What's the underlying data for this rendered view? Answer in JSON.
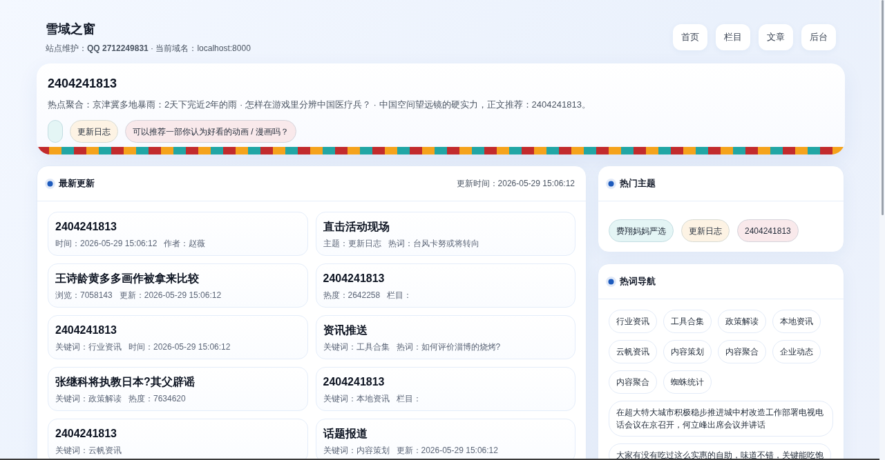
{
  "site": {
    "title": "雪域之窗",
    "subtitle": "站点维护：**QQ 2712249831** · 当前域名：localhost:8000"
  },
  "nav": [
    "首页",
    "栏目",
    "文章",
    "后台"
  ],
  "hero": {
    "title": "2404241813",
    "text": "热点聚合：京津冀多地暴雨：2天下完近2年的雨 · 怎样在游戏里分辨中国医疗兵？ · 中国空间望远镜的硬实力，正文推荐：2404241813。",
    "tags": [
      {
        "color": "#e4f5f5"
      },
      {
        "label": "更新日志",
        "color": "#fdf3e4"
      },
      {
        "label": "可以推荐一部你认为好看的动画 / 漫画吗？",
        "color": "#f9e9eb"
      }
    ]
  },
  "latest": {
    "title": "最新更新",
    "updated": "更新时间：2026-05-29 15:06:12",
    "cards": [
      {
        "title": "2404241813",
        "meta": [
          "时间：2026-05-29 15:06:12",
          "作者：赵薇"
        ]
      },
      {
        "title": "直击活动现场",
        "meta": [
          "主题：更新日志",
          "热词：台风卡努或将转向"
        ]
      },
      {
        "title": "王诗龄黄多多画作被拿来比较",
        "meta": [
          "浏览：7058143",
          "更新：2026-05-29 15:06:12"
        ]
      },
      {
        "title": "2404241813",
        "meta": [
          "热度：2642258",
          "栏目："
        ]
      },
      {
        "title": "2404241813",
        "meta": [
          "关键词：行业资讯",
          "时间：2026-05-29 15:06:12"
        ]
      },
      {
        "title": "资讯推送",
        "meta": [
          "关键词：工具合集",
          "热词：如何评价淄博的烧烤?"
        ]
      },
      {
        "title": "张继科将执教日本?其父辟谣",
        "meta": [
          "关键词：政策解读",
          "热度：7634620"
        ]
      },
      {
        "title": "2404241813",
        "meta": [
          "关键词：本地资讯",
          "栏目："
        ]
      },
      {
        "title": "2404241813",
        "meta": [
          "关键词：云帆资讯"
        ]
      },
      {
        "title": "话题报道",
        "meta": [
          "关键词：内容策划",
          "更新：2026-05-29 15:06:12"
        ]
      }
    ]
  },
  "hot_topics": {
    "title": "热门主题",
    "tags": [
      {
        "label": "费翔妈妈严选",
        "color": "#e4f5f5"
      },
      {
        "label": "更新日志",
        "color": "#fdf3e4"
      },
      {
        "label": "2404241813",
        "color": "#f9e9eb"
      }
    ]
  },
  "hot_words": {
    "title": "热词导航",
    "chips": [
      "行业资讯",
      "工具合集",
      "政策解读",
      "本地资讯",
      "云帆资讯",
      "内容策划",
      "内容聚合",
      "企业动态",
      "内容聚合",
      "蜘蛛统计",
      "在超大特大城市积极稳步推进城中村改造工作部署电视电话会议在京召开，何立峰出席会议并讲话",
      "大家有没有吃过这么实惠的自助，味道不错，关键能吃饱"
    ]
  }
}
